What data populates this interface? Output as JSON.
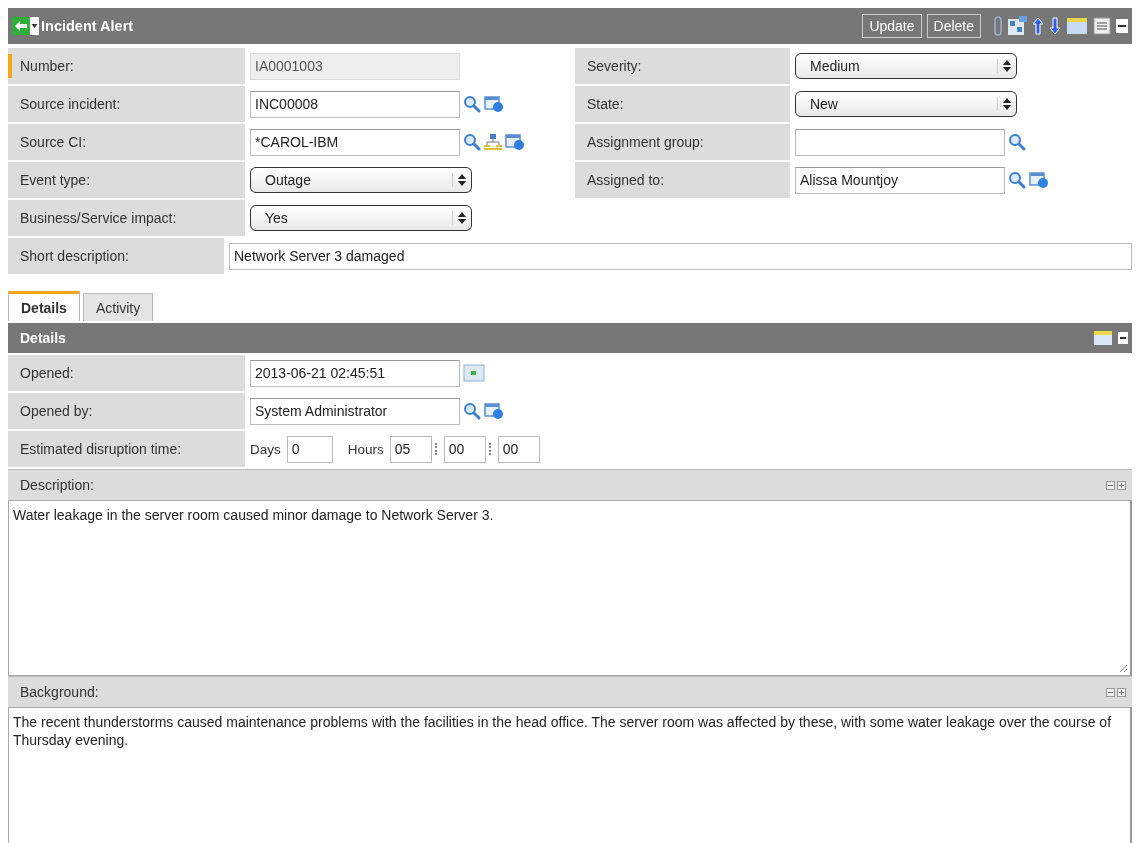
{
  "header": {
    "title": "Incident Alert",
    "buttons": [
      "Update",
      "Delete"
    ]
  },
  "left_fields": [
    {
      "label": "Number:",
      "kind": "readonly",
      "value": "IA0001003",
      "required": true
    },
    {
      "label": "Source incident:",
      "kind": "reference",
      "value": "INC00008",
      "required": false
    },
    {
      "label": "Source CI:",
      "kind": "ci-reference",
      "value": "*CAROL-IBM",
      "required": false
    },
    {
      "label": "Event type:",
      "kind": "select",
      "value": "Outage",
      "required": false
    },
    {
      "label": "Business/Service impact:",
      "kind": "select",
      "value": "Yes",
      "required": false
    }
  ],
  "right_fields": [
    {
      "label": "Severity:",
      "kind": "select",
      "value": "Medium",
      "required": false
    },
    {
      "label": "State:",
      "kind": "select",
      "value": "New",
      "required": false
    },
    {
      "label": "Assignment group:",
      "kind": "lookup",
      "required": false
    },
    {
      "label": "Assigned to:",
      "kind": "reference",
      "value": "Alissa Mountjoy",
      "required": false
    }
  ],
  "short_description": {
    "label": "Short description:",
    "value": "Network Server 3 damaged"
  },
  "tabs": [
    {
      "label": "Details",
      "selected": true
    },
    {
      "label": "Activity",
      "selected": false
    }
  ],
  "details": {
    "title": "Details",
    "fields": [
      {
        "label": "Opened:",
        "kind": "date",
        "value": "2013-06-21 02:45:51"
      },
      {
        "label": "Opened by:",
        "kind": "reference",
        "value": "System Administrator"
      },
      {
        "label": "Estimated disruption time:",
        "kind": "duration",
        "days_label": "Days",
        "days": "0",
        "hours_label": "Hours",
        "hours": "05",
        "minutes": "00",
        "seconds": "00"
      }
    ]
  },
  "description": {
    "label": "Description:",
    "value": "Water leakage in the server room caused minor damage to Network Server 3."
  },
  "background": {
    "label": "Background:",
    "value": "The recent thunderstorms caused maintenance problems with the facilities in the head office. The server room was affected by these, with some water leakage over the course of Thursday evening."
  }
}
